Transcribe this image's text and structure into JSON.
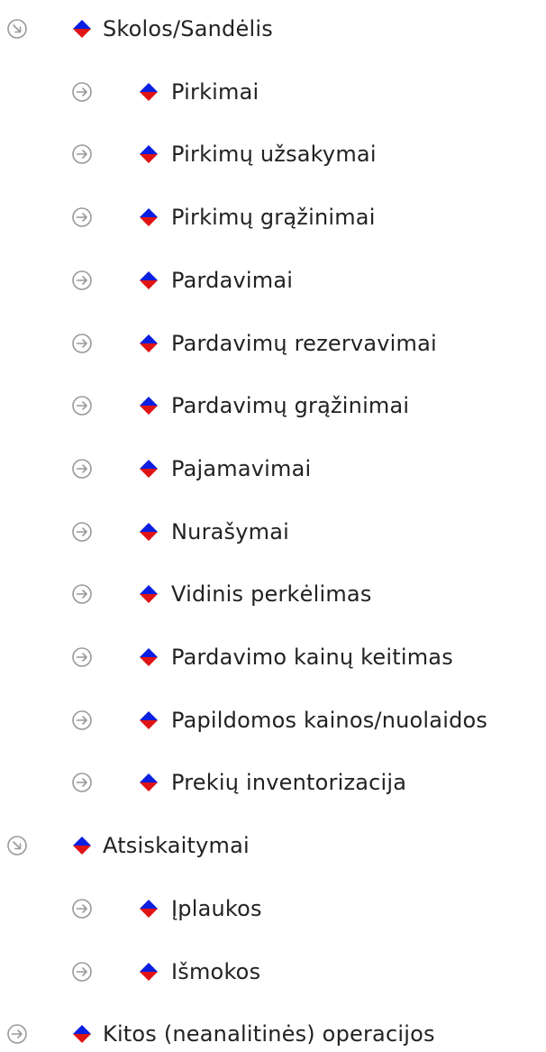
{
  "colors": {
    "diamond_top": "#0b1fe0",
    "diamond_bottom": "#e01414",
    "toggle_stroke": "#999999",
    "text": "#222222"
  },
  "tree": [
    {
      "label": "Skolos/Sandėlis",
      "state": "expanded",
      "level": 0,
      "icon": "collapse-toggle-icon"
    },
    {
      "label": "Pirkimai",
      "state": "collapsed",
      "level": 1,
      "icon": "expand-toggle-icon"
    },
    {
      "label": "Pirkimų užsakymai",
      "state": "collapsed",
      "level": 1,
      "icon": "expand-toggle-icon"
    },
    {
      "label": "Pirkimų grąžinimai",
      "state": "collapsed",
      "level": 1,
      "icon": "expand-toggle-icon"
    },
    {
      "label": "Pardavimai",
      "state": "collapsed",
      "level": 1,
      "icon": "expand-toggle-icon"
    },
    {
      "label": "Pardavimų rezervavimai",
      "state": "collapsed",
      "level": 1,
      "icon": "expand-toggle-icon"
    },
    {
      "label": "Pardavimų grąžinimai",
      "state": "collapsed",
      "level": 1,
      "icon": "expand-toggle-icon"
    },
    {
      "label": "Pajamavimai",
      "state": "collapsed",
      "level": 1,
      "icon": "expand-toggle-icon"
    },
    {
      "label": "Nurašymai",
      "state": "collapsed",
      "level": 1,
      "icon": "expand-toggle-icon"
    },
    {
      "label": "Vidinis perkėlimas",
      "state": "collapsed",
      "level": 1,
      "icon": "expand-toggle-icon"
    },
    {
      "label": "Pardavimo kainų keitimas",
      "state": "collapsed",
      "level": 1,
      "icon": "expand-toggle-icon"
    },
    {
      "label": "Papildomos kainos/nuolaidos",
      "state": "collapsed",
      "level": 1,
      "icon": "expand-toggle-icon"
    },
    {
      "label": "Prekių inventorizacija",
      "state": "collapsed",
      "level": 1,
      "icon": "expand-toggle-icon"
    },
    {
      "label": "Atsiskaitymai",
      "state": "expanded",
      "level": 0,
      "icon": "collapse-toggle-icon"
    },
    {
      "label": "Įplaukos",
      "state": "collapsed",
      "level": 1,
      "icon": "expand-toggle-icon"
    },
    {
      "label": "Išmokos",
      "state": "collapsed",
      "level": 1,
      "icon": "expand-toggle-icon"
    },
    {
      "label": "Kitos (neanalitinės) operacijos",
      "state": "collapsed",
      "level": 0,
      "icon": "expand-toggle-icon"
    }
  ]
}
